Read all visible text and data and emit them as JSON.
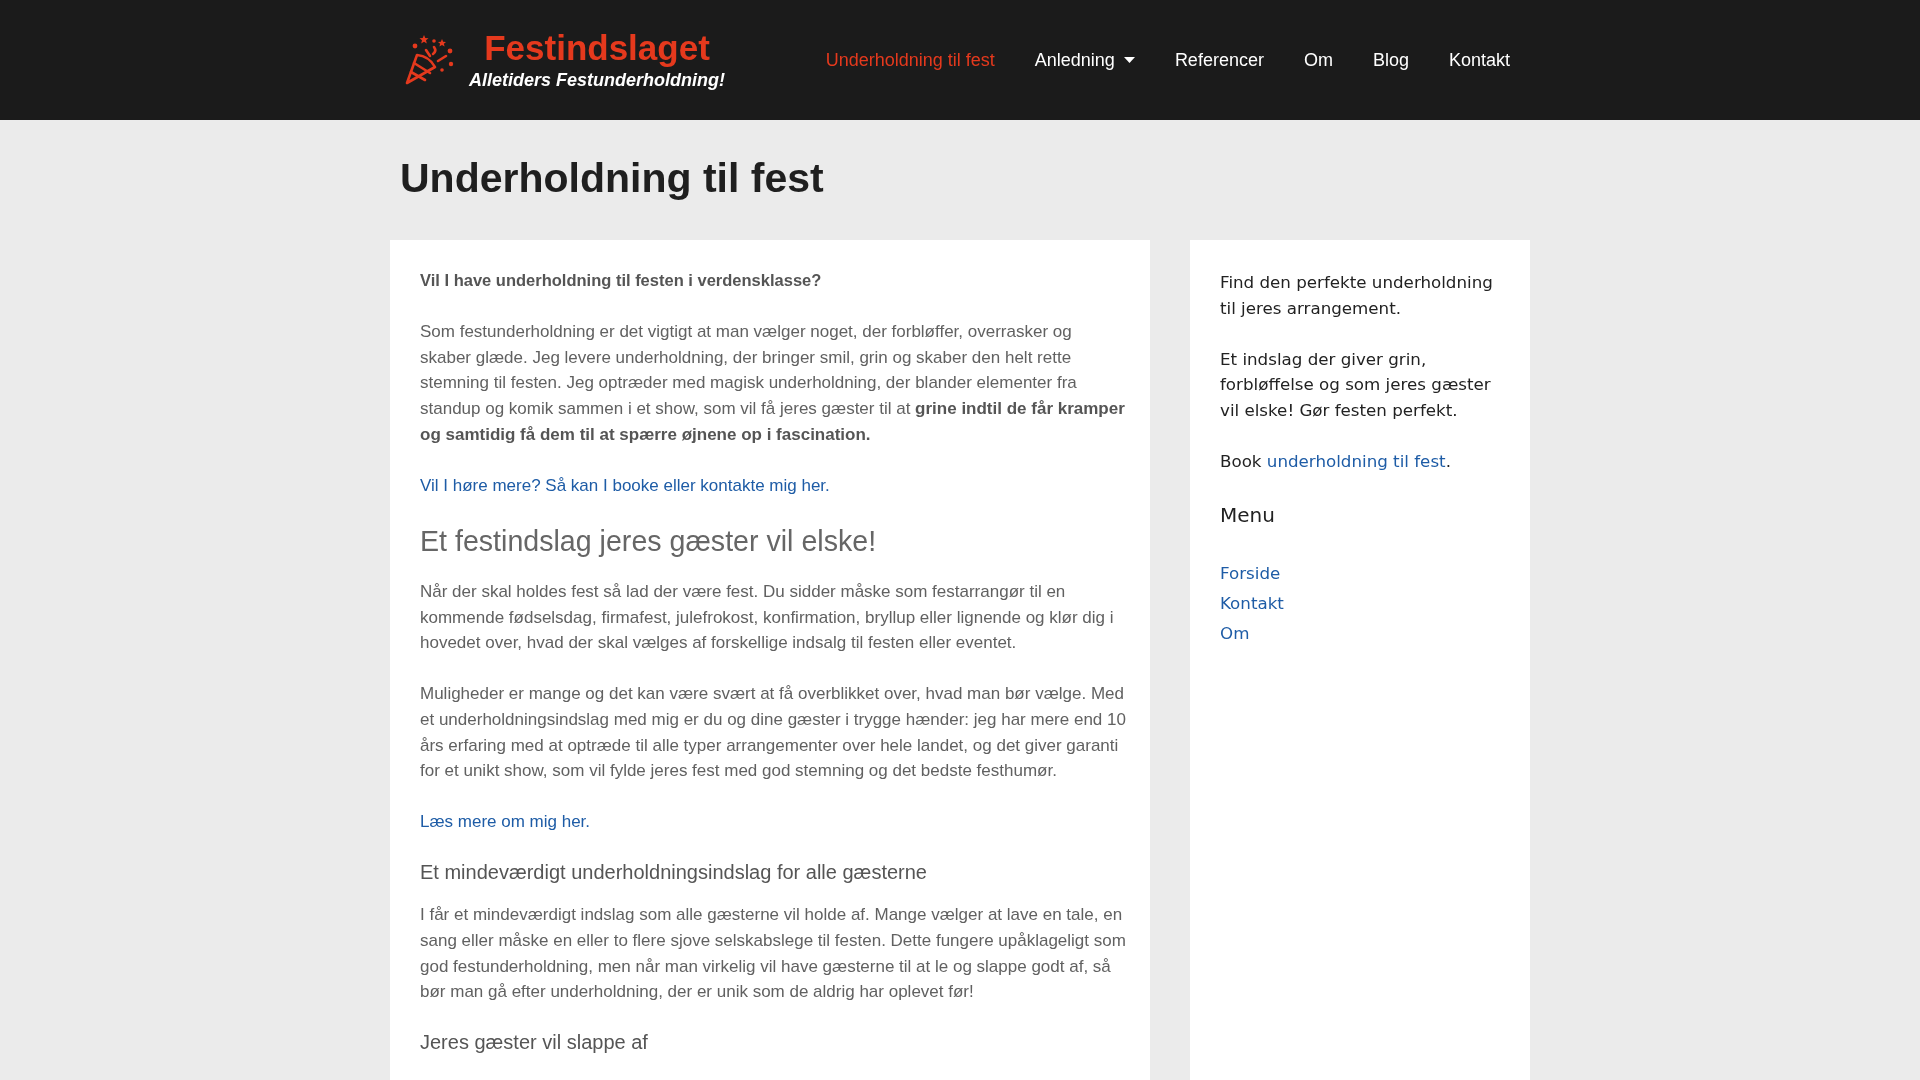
{
  "header": {
    "logo": {
      "name": "Festindslaget",
      "tagline": "Alletiders Festunderholdning!"
    },
    "nav": [
      {
        "label": "Underholdning til fest",
        "selected": true,
        "submenu": false
      },
      {
        "label": "Anledning",
        "selected": false,
        "submenu": true
      },
      {
        "label": "Referencer",
        "selected": false,
        "submenu": false
      },
      {
        "label": "Om",
        "selected": false,
        "submenu": false
      },
      {
        "label": "Blog",
        "selected": false,
        "submenu": false
      },
      {
        "label": "Kontakt",
        "selected": false,
        "submenu": false
      }
    ]
  },
  "page_title": "Underholdning til fest",
  "content": {
    "blocks": [
      {
        "kind": "lead",
        "text": "Vil I have underholdning til festen i verdensklasse?"
      },
      {
        "kind": "paragraph",
        "text": "Som festunderholdning er det vigtigt at man vælger noget, der forbløffer, overrasker og skaber glæde. Jeg levere underholdning, der bringer smil, grin og skaber den helt rette stemning til festen. Jeg optræder med magisk underholdning, der blander elementer fra standup og komik sammen i et show, som vil få jeres gæster til at **grine indtil de får kramper og samtidig få dem til at spærre øjnene op i fascination.**"
      },
      {
        "kind": "link",
        "text": "Vil I høre mere? Så kan I booke eller kontakte mig her."
      },
      {
        "kind": "heading",
        "text": "Et festindslag jeres gæster vil elske!"
      },
      {
        "kind": "paragraph",
        "text": "Når der skal holdes fest så lad der være fest. Du sidder måske som festarrangør til en kommende fødselsdag, firmafest, julefrokost, konfirmation, bryllup eller lignende og klør dig i hovedet over, hvad der skal vælges af forskellige indsalg til festen eller eventet."
      },
      {
        "kind": "paragraph",
        "text": "Muligheder er mange og det kan være svært at få overblikket over, hvad man bør vælge. Med et underholdningsindslag med mig er du og dine gæster i trygge hænder: jeg har mere end 10 års erfaring med at optræde til alle typer arrangementer over hele landet, og det giver garanti for et unikt show, som vil fylde jeres fest med god stemning og det bedste festhumør."
      },
      {
        "kind": "link",
        "text": "Læs mere om mig her."
      },
      {
        "kind": "subheading",
        "text": "Et mindeværdigt underholdningsindslag for alle gæsterne"
      },
      {
        "kind": "paragraph",
        "text": "I får et mindeværdigt indslag som alle gæsterne vil holde af. Mange vælger at lave en tale, en sang eller måske en eller to flere sjove selskabslege til festen. Dette fungere upåklageligt som god festunderholdning, men når man virkelig vil have gæsterne til at le og slappe godt af, så bør man gå efter underholdning, der er unik som de aldrig har oplevet før!"
      },
      {
        "kind": "subheading",
        "text": "Jeres gæster vil slappe af"
      }
    ]
  },
  "sidebar": {
    "blocks": [
      {
        "kind": "paragraph",
        "text": "Find den perfekte underholdning til jeres arrangement."
      },
      {
        "kind": "paragraph",
        "text": "Et indslag der giver grin, forbløffelse og som jeres gæster vil elske! Gør festen perfekt."
      },
      {
        "kind": "link_paragraph",
        "before": "Book ",
        "link": "underholdning til fest",
        "after": "."
      }
    ],
    "menu": {
      "title": "Menu",
      "items": [
        "Forside",
        "Kontakt",
        "Om"
      ]
    }
  }
}
